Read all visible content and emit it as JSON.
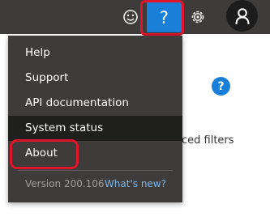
{
  "topbar": {
    "smiley_icon": "smiley-icon",
    "help_label": "?",
    "settings_icon": "gear-icon",
    "profile_icon": "person-icon"
  },
  "content": {
    "info_icon": "?",
    "partial_text": "ced filters"
  },
  "help_menu": {
    "items": [
      {
        "label": "Help"
      },
      {
        "label": "Support"
      },
      {
        "label": "API documentation"
      },
      {
        "label": "System status"
      },
      {
        "label": "About"
      }
    ],
    "version": "Version 200.106",
    "whats_new": "What's new?"
  },
  "colors": {
    "topbar_bg": "#3d3c3a",
    "accent": "#1a7fd8",
    "highlight": "#e0142b",
    "menu_active": "#1f1f1e"
  }
}
